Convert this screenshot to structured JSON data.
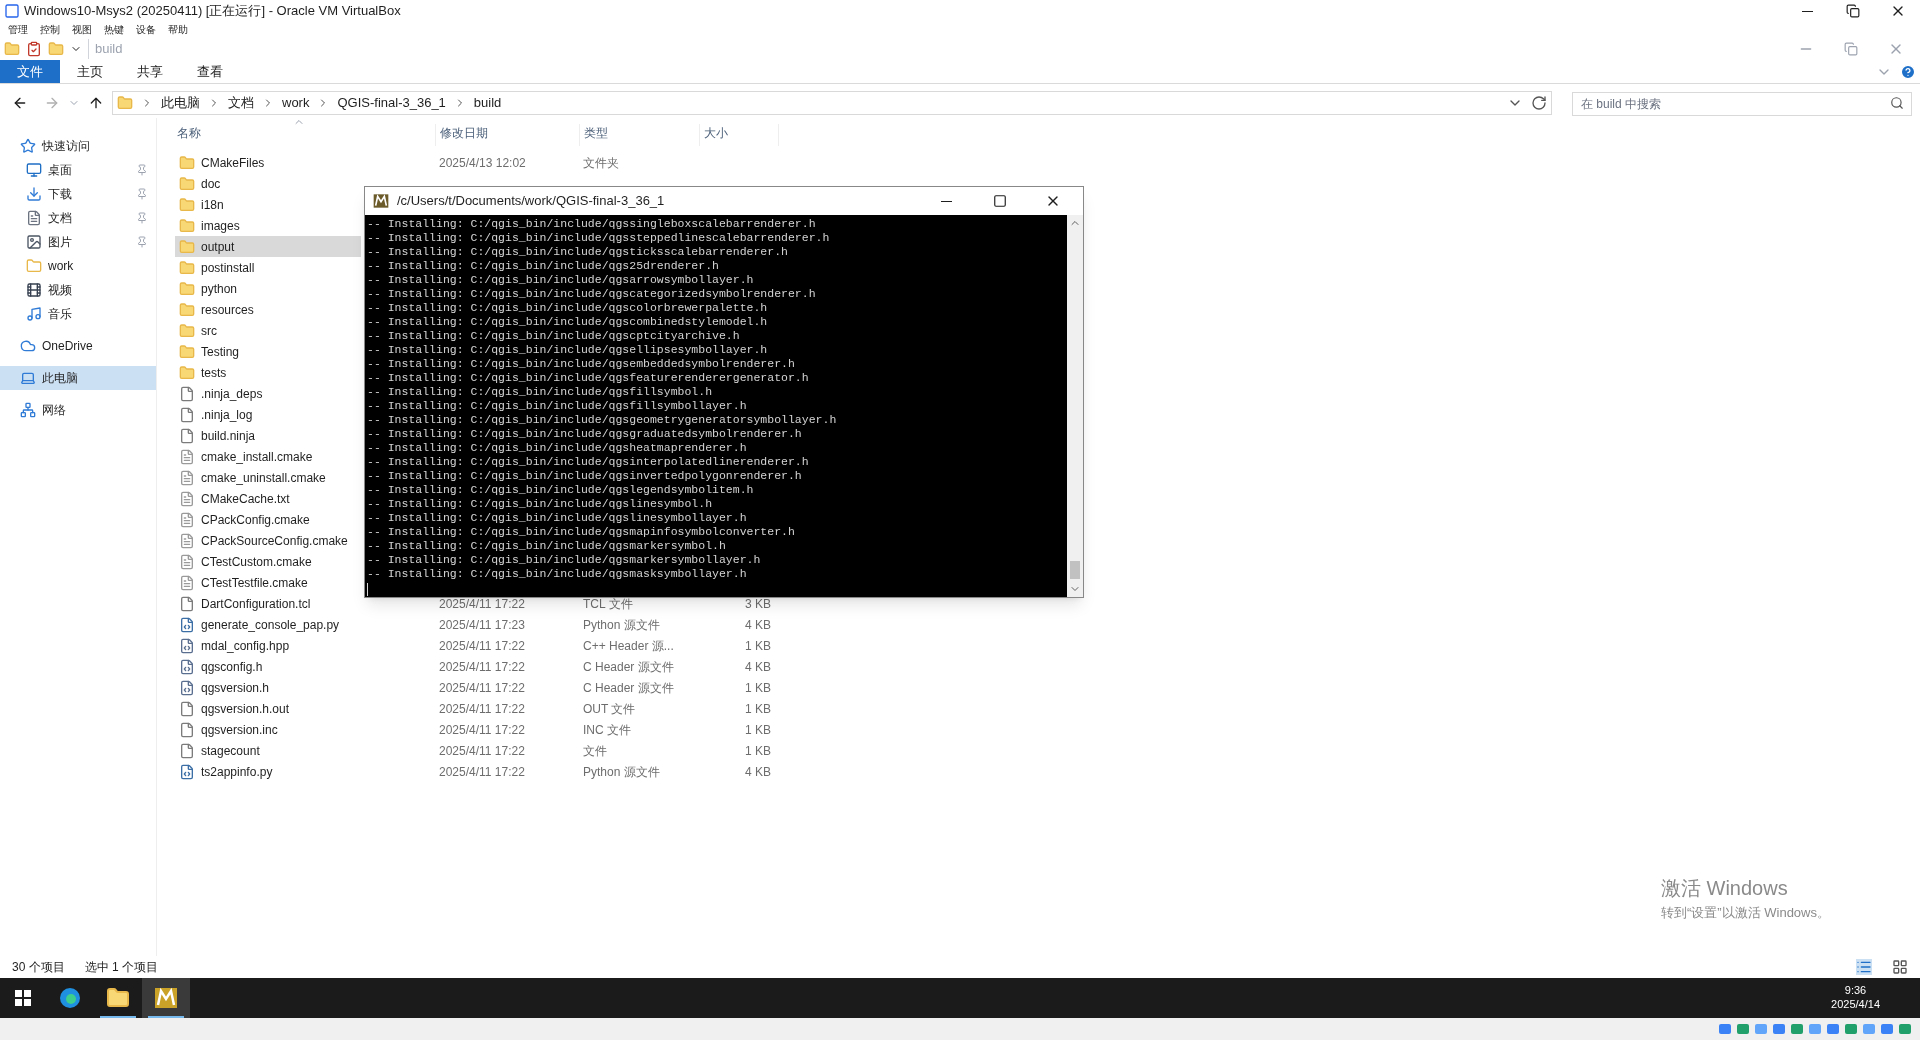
{
  "vbox": {
    "title": "Windows10-Msys2 (20250411) [正在运行] - Oracle VM VirtualBox",
    "menu": [
      "管理",
      "控制",
      "视图",
      "热键",
      "设备",
      "帮助"
    ]
  },
  "explorer": {
    "qat_title": "build",
    "ribbon_tabs": [
      {
        "label": "文件",
        "selected": true
      },
      {
        "label": "主页",
        "selected": false
      },
      {
        "label": "共享",
        "selected": false
      },
      {
        "label": "查看",
        "selected": false
      }
    ],
    "breadcrumb": [
      "此电脑",
      "文档",
      "work",
      "QGIS-final-3_36_1",
      "build"
    ],
    "search": {
      "placeholder": "在 build 中搜索"
    },
    "nav": [
      {
        "label": "快速访问",
        "selected": false,
        "children": [
          {
            "label": "桌面",
            "pinned": true,
            "selected": false
          },
          {
            "label": "下载",
            "pinned": true,
            "selected": false
          },
          {
            "label": "文档",
            "pinned": true,
            "selected": false
          },
          {
            "label": "图片",
            "pinned": true,
            "selected": false
          },
          {
            "label": "work",
            "pinned": false,
            "selected": false
          },
          {
            "label": "视频",
            "pinned": false,
            "selected": false
          },
          {
            "label": "音乐",
            "pinned": false,
            "selected": false
          }
        ]
      },
      {
        "label": "OneDrive",
        "selected": false
      },
      {
        "label": "此电脑",
        "selected": true
      },
      {
        "label": "网络",
        "selected": false
      }
    ],
    "columns": [
      "名称",
      "修改日期",
      "类型",
      "大小"
    ],
    "rows": [
      {
        "name": "CMakeFiles",
        "kind": "folder",
        "selected": false,
        "date": "2025/4/13 12:02",
        "type": "文件夹"
      },
      {
        "name": "doc",
        "kind": "folder",
        "selected": false
      },
      {
        "name": "i18n",
        "kind": "folder",
        "selected": false
      },
      {
        "name": "images",
        "kind": "folder",
        "selected": false
      },
      {
        "name": "output",
        "kind": "folder",
        "selected": true
      },
      {
        "name": "postinstall",
        "kind": "folder",
        "selected": false
      },
      {
        "name": "python",
        "kind": "folder",
        "selected": false
      },
      {
        "name": "resources",
        "kind": "folder",
        "selected": false
      },
      {
        "name": "src",
        "kind": "folder",
        "selected": false
      },
      {
        "name": "Testing",
        "kind": "folder",
        "selected": false
      },
      {
        "name": "tests",
        "kind": "folder",
        "selected": false
      },
      {
        "name": ".ninja_deps",
        "kind": "blank",
        "selected": false
      },
      {
        "name": ".ninja_log",
        "kind": "blank",
        "selected": false
      },
      {
        "name": "build.ninja",
        "kind": "blank",
        "selected": false
      },
      {
        "name": "cmake_install.cmake",
        "kind": "text",
        "selected": false
      },
      {
        "name": "cmake_uninstall.cmake",
        "kind": "text",
        "selected": false
      },
      {
        "name": "CMakeCache.txt",
        "kind": "text",
        "selected": false
      },
      {
        "name": "CPackConfig.cmake",
        "kind": "text",
        "selected": false
      },
      {
        "name": "CPackSourceConfig.cmake",
        "kind": "text",
        "selected": false
      },
      {
        "name": "CTestCustom.cmake",
        "kind": "text",
        "selected": false
      },
      {
        "name": "CTestTestfile.cmake",
        "kind": "text",
        "selected": false
      },
      {
        "name": "DartConfiguration.tcl",
        "kind": "blank",
        "selected": false,
        "date": "2025/4/11 17:22",
        "type": "TCL 文件",
        "size": "3 KB"
      },
      {
        "name": "generate_console_pap.py",
        "kind": "script",
        "selected": false,
        "date": "2025/4/11 17:23",
        "type": "Python 源文件",
        "size": "4 KB"
      },
      {
        "name": "mdal_config.hpp",
        "kind": "code",
        "selected": false,
        "date": "2025/4/11 17:22",
        "type": "C++ Header 源...",
        "size": "1 KB"
      },
      {
        "name": "qgsconfig.h",
        "kind": "code",
        "selected": false,
        "date": "2025/4/11 17:22",
        "type": "C Header 源文件",
        "size": "4 KB"
      },
      {
        "name": "qgsversion.h",
        "kind": "code",
        "selected": false,
        "date": "2025/4/11 17:22",
        "type": "C Header 源文件",
        "size": "1 KB"
      },
      {
        "name": "qgsversion.h.out",
        "kind": "blank",
        "selected": false,
        "date": "2025/4/11 17:22",
        "type": "OUT 文件",
        "size": "1 KB"
      },
      {
        "name": "qgsversion.inc",
        "kind": "blank",
        "selected": false,
        "date": "2025/4/11 17:22",
        "type": "INC 文件",
        "size": "1 KB"
      },
      {
        "name": "stagecount",
        "kind": "blank",
        "selected": false,
        "date": "2025/4/11 17:22",
        "type": "文件",
        "size": "1 KB"
      },
      {
        "name": "ts2appinfo.py",
        "kind": "script",
        "selected": false,
        "date": "2025/4/11 17:22",
        "type": "Python 源文件",
        "size": "4 KB"
      }
    ],
    "status": [
      "30 个项目",
      "选中 1 个项目"
    ]
  },
  "terminal": {
    "title": "/c/Users/t/Documents/work/QGIS-final-3_36_1",
    "lines": [
      "-- Installing: C:/qgis_bin/include/qgssingleboxscalebarrenderer.h",
      "-- Installing: C:/qgis_bin/include/qgssteppedlinescalebarrenderer.h",
      "-- Installing: C:/qgis_bin/include/qgsticksscalebarrenderer.h",
      "-- Installing: C:/qgis_bin/include/qgs25drenderer.h",
      "-- Installing: C:/qgis_bin/include/qgsarrowsymbollayer.h",
      "-- Installing: C:/qgis_bin/include/qgscategorizedsymbolrenderer.h",
      "-- Installing: C:/qgis_bin/include/qgscolorbrewerpalette.h",
      "-- Installing: C:/qgis_bin/include/qgscombinedstylemodel.h",
      "-- Installing: C:/qgis_bin/include/qgscptcityarchive.h",
      "-- Installing: C:/qgis_bin/include/qgsellipsesymbollayer.h",
      "-- Installing: C:/qgis_bin/include/qgsembeddedsymbolrenderer.h",
      "-- Installing: C:/qgis_bin/include/qgsfeaturerenderergenerator.h",
      "-- Installing: C:/qgis_bin/include/qgsfillsymbol.h",
      "-- Installing: C:/qgis_bin/include/qgsfillsymbollayer.h",
      "-- Installing: C:/qgis_bin/include/qgsgeometrygeneratorsymbollayer.h",
      "-- Installing: C:/qgis_bin/include/qgsgraduatedsymbolrenderer.h",
      "-- Installing: C:/qgis_bin/include/qgsheatmaprenderer.h",
      "-- Installing: C:/qgis_bin/include/qgsinterpolatedlinerenderer.h",
      "-- Installing: C:/qgis_bin/include/qgsinvertedpolygonrenderer.h",
      "-- Installing: C:/qgis_bin/include/qgslegendsymbolitem.h",
      "-- Installing: C:/qgis_bin/include/qgslinesymbol.h",
      "-- Installing: C:/qgis_bin/include/qgslinesymbollayer.h",
      "-- Installing: C:/qgis_bin/include/qgsmapinfosymbolconverter.h",
      "-- Installing: C:/qgis_bin/include/qgsmarkersymbol.h",
      "-- Installing: C:/qgis_bin/include/qgsmarkersymbollayer.h",
      "-- Installing: C:/qgis_bin/include/qgsmasksymbollayer.h"
    ]
  },
  "activation": {
    "title": "激活 Windows",
    "hint": "转到“设置”以激活 Windows。"
  },
  "taskbar": {
    "apps": [
      {
        "kind": "browser",
        "running": false,
        "selected": false
      },
      {
        "kind": "explorer",
        "running": true,
        "selected": false
      },
      {
        "kind": "terminal",
        "running": true,
        "selected": true
      }
    ],
    "clock": {
      "time": "9:36",
      "date": "2025/4/14"
    }
  }
}
